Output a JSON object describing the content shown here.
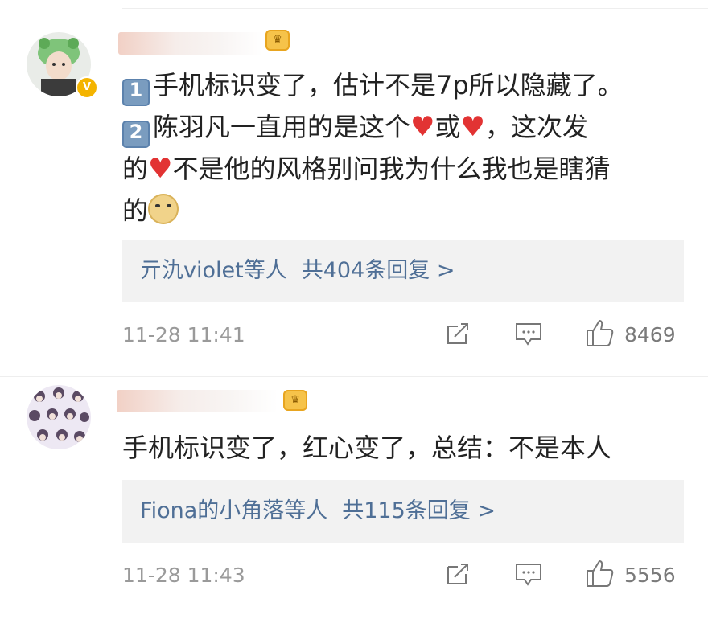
{
  "comments": [
    {
      "text": {
        "line1": "手机标识变了，估计不是7p所以隐藏了。",
        "num1": "1",
        "num2": "2",
        "line2_a": "陈羽凡一直用的是这个",
        "line2_b": "或",
        "line2_c": "，这次发",
        "line3_a": "的",
        "line3_b": "不是他的风格别问我为什么我也是瞎猜",
        "line4_a": "的"
      },
      "replies": {
        "user": "亓氿violet等人",
        "summary": "共404条回复 >"
      },
      "timestamp": "11-28 11:41",
      "likes": "8469"
    },
    {
      "text": {
        "line1": "手机标识变了，红心变了，总结：不是本人"
      },
      "replies": {
        "user": "Fiona的小角落等人",
        "summary": "共115条回复 >"
      },
      "timestamp": "11-28 11:43",
      "likes": "5556"
    }
  ],
  "icons": {
    "heart": "♥",
    "verified": "V",
    "vip": "👑"
  }
}
